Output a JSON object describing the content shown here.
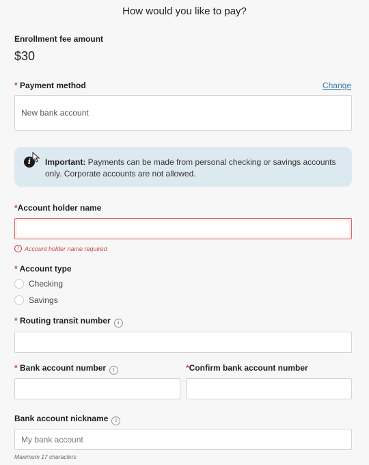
{
  "page": {
    "title": "How would you like to pay?"
  },
  "fee": {
    "label": "Enrollment fee amount",
    "amount": "$30"
  },
  "payment_method": {
    "required_mark": "*",
    "label": "Payment method",
    "change_link": "Change",
    "value": "New bank account"
  },
  "notice": {
    "icon": "info-icon",
    "bold": "Important:",
    "text": "Payments can be made from personal checking or savings accounts only. Corporate accounts are not allowed."
  },
  "account_holder": {
    "required_mark": "*",
    "label": "Account holder name",
    "value": "",
    "error_icon": "!",
    "error": "Account holder name required"
  },
  "account_type": {
    "required_mark": "*",
    "label": "Account type",
    "options": [
      {
        "label": "Checking",
        "selected": false
      },
      {
        "label": "Savings",
        "selected": false
      }
    ]
  },
  "routing": {
    "required_mark": "*",
    "label": "Routing transit number",
    "info_icon": "i",
    "value": ""
  },
  "bank_account": {
    "required_mark": "*",
    "label": "Bank account number",
    "info_icon": "i",
    "value": ""
  },
  "confirm_account": {
    "required_mark": "*",
    "label": "Confirm bank account number",
    "value": ""
  },
  "nickname": {
    "label": "Bank account nickname",
    "info_icon": "i",
    "placeholder": "My bank account",
    "hint": "Maximum 17 characters"
  },
  "colors": {
    "background": "#f7f7f7",
    "required": "#c94646",
    "link": "#3a7ca8",
    "notice_bg": "#dde9f0",
    "error_border": "#d76565"
  }
}
